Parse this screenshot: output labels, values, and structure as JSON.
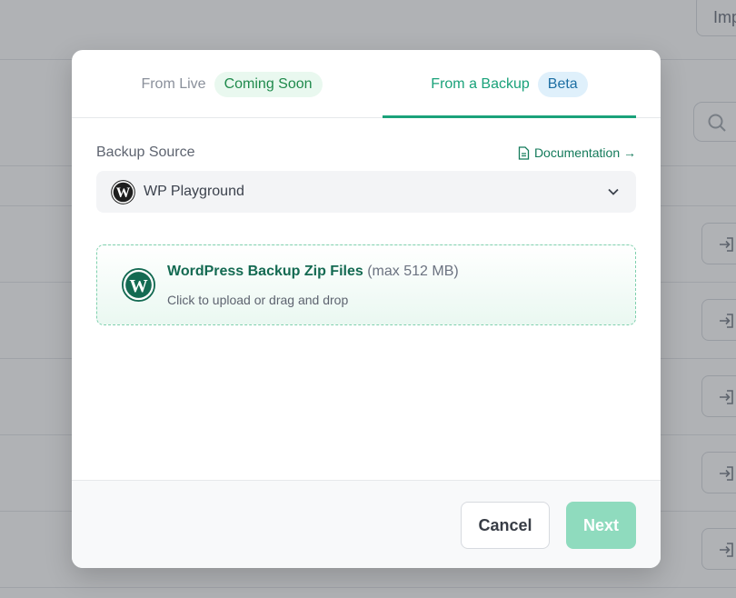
{
  "background": {
    "import_button_label": "Imp"
  },
  "modal": {
    "tabs": [
      {
        "label": "From Live",
        "badge": "Coming Soon",
        "active": false
      },
      {
        "label": "From a Backup",
        "badge": "Beta",
        "active": true
      }
    ],
    "backup_source": {
      "label": "Backup Source",
      "documentation_link": "Documentation →",
      "selected": "WP Playground"
    },
    "upload": {
      "title": "WordPress Backup Zip Files",
      "limit": "(max 512 MB)",
      "hint": "Click to upload or drag and drop"
    },
    "footer": {
      "cancel_label": "Cancel",
      "next_label": "Next"
    }
  },
  "colors": {
    "accent": "#1aa27a",
    "next_disabled": "#8fdbbe",
    "badge_soon_bg": "#e9f8ef",
    "badge_beta_bg": "#dff0fb"
  }
}
